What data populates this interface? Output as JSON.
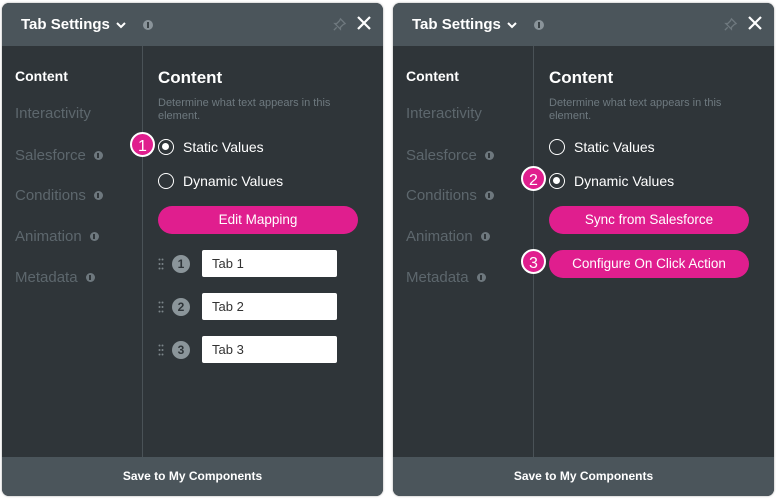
{
  "panels": [
    {
      "header": {
        "title": "Tab Settings"
      },
      "sidebar": {
        "items": [
          {
            "label": "Content",
            "active": true
          },
          {
            "label": "Interactivity"
          },
          {
            "label": "Salesforce"
          },
          {
            "label": "Conditions"
          },
          {
            "label": "Animation"
          },
          {
            "label": "Metadata"
          }
        ]
      },
      "content": {
        "heading": "Content",
        "description": "Determine what text appears in this element.",
        "radio_static": "Static Values",
        "radio_dynamic": "Dynamic Values",
        "selected": "static",
        "primary_button": "Edit Mapping",
        "tabs": [
          {
            "index": "1",
            "value": "Tab 1"
          },
          {
            "index": "2",
            "value": "Tab 2"
          },
          {
            "index": "3",
            "value": "Tab 3"
          }
        ]
      },
      "footer": "Save to My Components",
      "callouts": [
        "1"
      ]
    },
    {
      "header": {
        "title": "Tab Settings"
      },
      "sidebar": {
        "items": [
          {
            "label": "Content",
            "active": true
          },
          {
            "label": "Interactivity"
          },
          {
            "label": "Salesforce"
          },
          {
            "label": "Conditions"
          },
          {
            "label": "Animation"
          },
          {
            "label": "Metadata"
          }
        ]
      },
      "content": {
        "heading": "Content",
        "description": "Determine what text appears in this element.",
        "radio_static": "Static Values",
        "radio_dynamic": "Dynamic Values",
        "selected": "dynamic",
        "primary_button": "Sync from Salesforce",
        "secondary_button": "Configure On Click Action"
      },
      "footer": "Save to My Components",
      "callouts": [
        "2",
        "3"
      ]
    }
  ],
  "colors": {
    "accent": "#e01e8e",
    "panel_bg": "#2f3539",
    "header_bg": "#4b555b"
  }
}
